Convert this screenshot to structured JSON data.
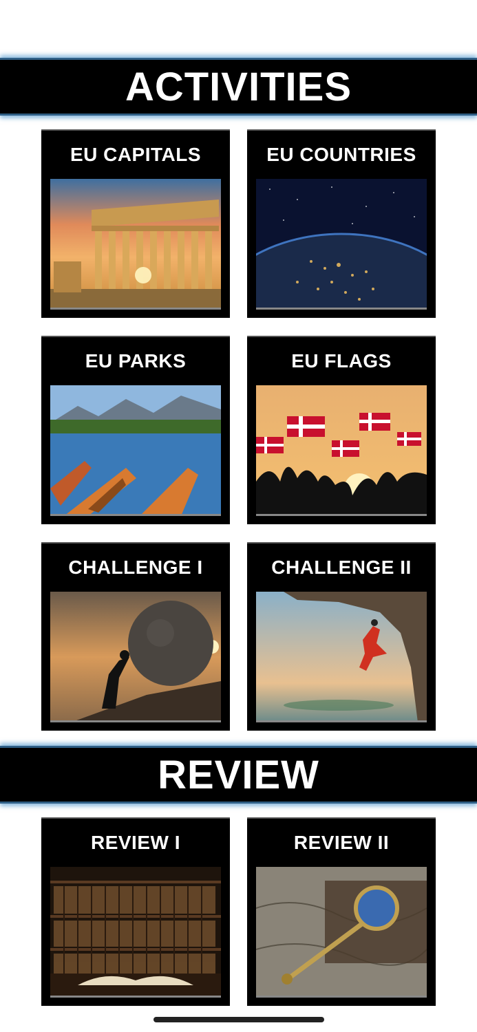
{
  "sections": {
    "activities_title": "ACTIVITIES",
    "review_title": "REVIEW"
  },
  "tiles": {
    "eu_capitals": "EU CAPITALS",
    "eu_countries": "EU COUNTRIES",
    "eu_parks": "EU PARKS",
    "eu_flags": "EU FLAGS",
    "challenge_1": "CHALLENGE I",
    "challenge_2": "CHALLENGE II",
    "review_1": "REVIEW I",
    "review_2": "REVIEW II"
  },
  "colors": {
    "banner_bg": "#000000",
    "banner_glow": "#3c8cc8",
    "tile_bg": "#000000",
    "text": "#ffffff"
  }
}
